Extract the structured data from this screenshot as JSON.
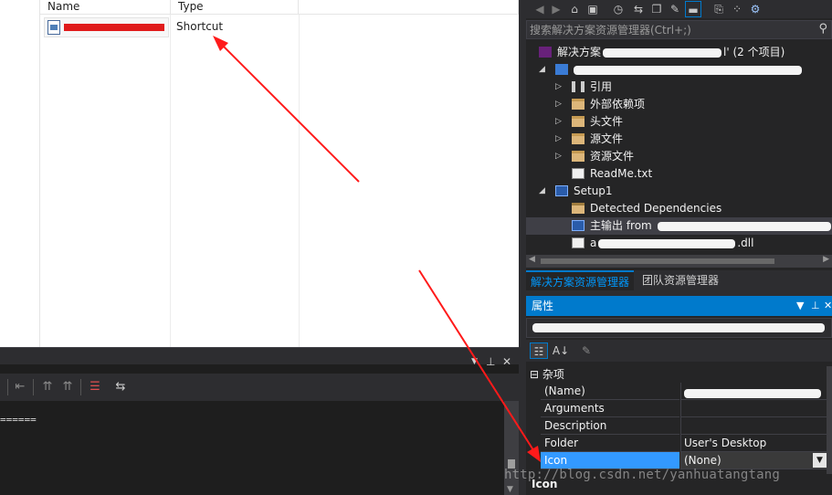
{
  "file_pane": {
    "columns": [
      "Name",
      "Type"
    ],
    "row": {
      "name_visible": "...",
      "type": "Shortcut"
    }
  },
  "output": {
    "pin": "📌",
    "close": "✕",
    "text": "======"
  },
  "solution_explorer": {
    "search_placeholder": "搜索解决方案资源管理器(Ctrl+;)",
    "solution_label_prefix": "解决方案",
    "solution_label_suffix": "l' (2 个项目)",
    "items": [
      {
        "label": "引用"
      },
      {
        "label": "外部依赖项"
      },
      {
        "label": "头文件"
      },
      {
        "label": "源文件"
      },
      {
        "label": "资源文件"
      },
      {
        "label": "ReadMe.txt"
      },
      {
        "label": "Setup1"
      },
      {
        "label": "Detected Dependencies"
      },
      {
        "label": "主输出 from"
      },
      {
        "label_prefix": "a",
        "label_suffix": ".dll"
      }
    ],
    "tabs": [
      "解决方案资源管理器",
      "团队资源管理器"
    ]
  },
  "properties": {
    "title": "属性",
    "pin": "▾ 📌 ✕",
    "category": "杂项",
    "rows": [
      {
        "name": "(Name)",
        "value": ""
      },
      {
        "name": "Arguments",
        "value": ""
      },
      {
        "name": "Description",
        "value": ""
      },
      {
        "name": "Folder",
        "value": "User's Desktop"
      },
      {
        "name": "Icon",
        "value": "(None)"
      }
    ],
    "description_title": "Icon"
  },
  "watermark": "http://blog.csdn.net/yanhuatangtang",
  "colors": {
    "accent": "#007acc",
    "selected_row": "#3399ff",
    "annotation_arrow": "#ff1a1a"
  }
}
